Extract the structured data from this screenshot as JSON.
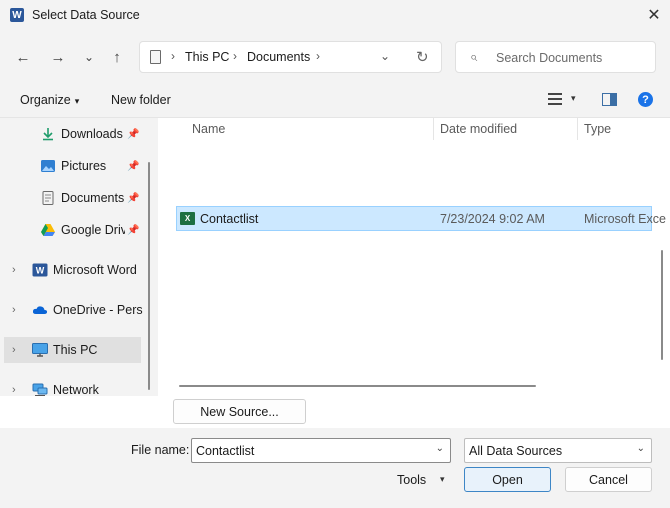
{
  "window": {
    "title": "Select Data Source",
    "app_icon": "W",
    "close_glyph": "✕"
  },
  "nav": {
    "back": "←",
    "forward": "→",
    "recent": "⌄",
    "up": "↑"
  },
  "address": {
    "crumbs": [
      "This PC",
      "Documents"
    ],
    "separator": "›",
    "dropdown": "⌄",
    "refresh": "↻"
  },
  "search": {
    "placeholder": "Search Documents",
    "icon": "⌕"
  },
  "commands": {
    "organize": "Organize",
    "new_folder": "New folder",
    "caret": "▾",
    "help": "?"
  },
  "sidebar": {
    "items": [
      {
        "label": "Downloads",
        "icon": "download-icon",
        "pinned": true
      },
      {
        "label": "Pictures",
        "icon": "pictures-icon",
        "pinned": true
      },
      {
        "label": "Documents",
        "icon": "documents-icon",
        "pinned": true
      },
      {
        "label": "Google Drive",
        "icon": "google-drive-icon",
        "pinned": true
      },
      {
        "label": "Microsoft Word",
        "icon": "word-icon",
        "expandable": true
      },
      {
        "label": "OneDrive - Personal",
        "icon": "onedrive-icon",
        "expandable": true
      },
      {
        "label": "This PC",
        "icon": "pc-icon",
        "expandable": true,
        "selected": true
      },
      {
        "label": "Network",
        "icon": "network-icon",
        "expandable": true
      }
    ],
    "pin_glyph": "📌",
    "chevron": "›"
  },
  "filelist": {
    "columns": [
      "Name",
      "Date modified",
      "Type"
    ],
    "sort_glyph": "⌃",
    "rows": [
      {
        "name": "Contactlist",
        "date": "7/23/2024 9:02 AM",
        "type": "Microsoft Excel",
        "icon_text": "X"
      }
    ]
  },
  "buttons": {
    "new_source": "New Source...",
    "open": "Open",
    "cancel": "Cancel"
  },
  "footer": {
    "file_name_label": "File name:",
    "file_name_value": "Contactlist",
    "filter_value": "All Data Sources",
    "tools_label": "Tools",
    "dd": "⌄"
  },
  "colors": {
    "accent": "#1a73e8",
    "selection": "#cce8ff",
    "excel": "#1d6f42",
    "word": "#2b579a"
  }
}
